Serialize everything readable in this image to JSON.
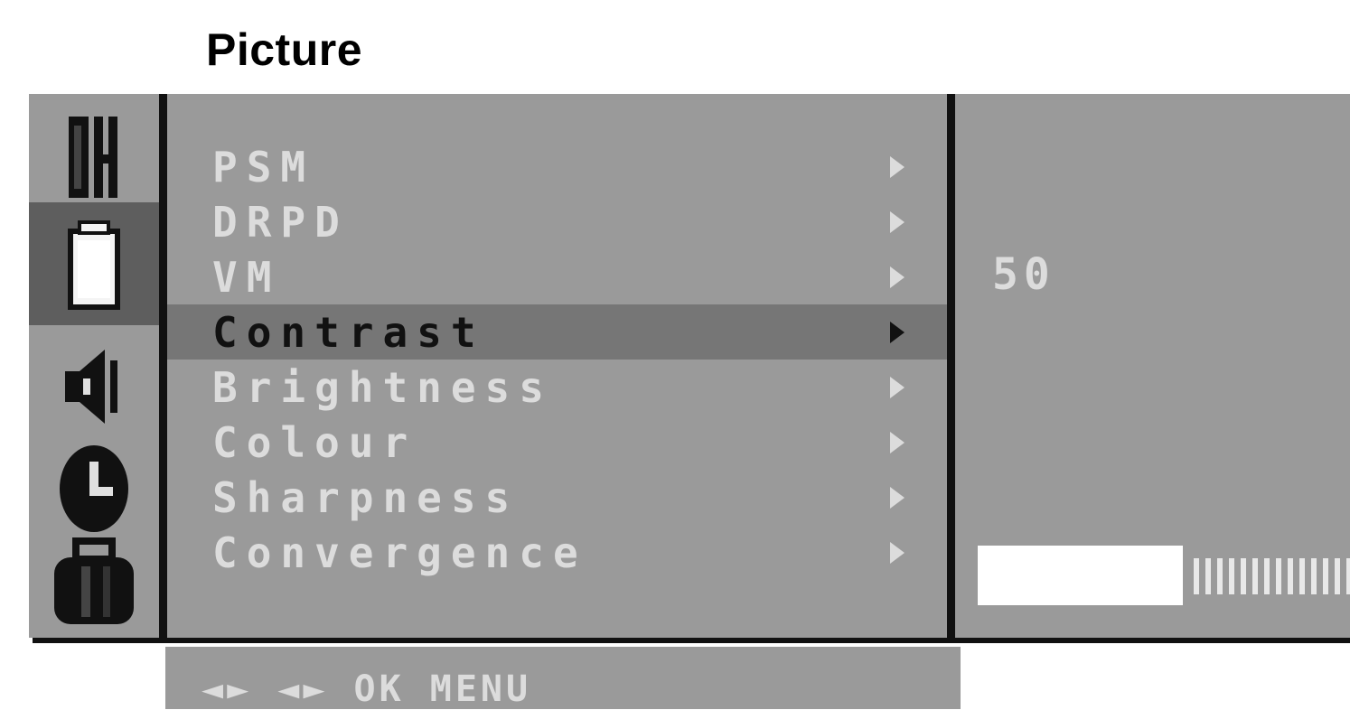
{
  "header": {
    "title": "Picture"
  },
  "sidebar": {
    "icons": [
      {
        "name": "channel-icon",
        "active": false
      },
      {
        "name": "picture-icon",
        "active": true
      },
      {
        "name": "sound-icon",
        "active": false
      },
      {
        "name": "time-icon",
        "active": false
      },
      {
        "name": "special-icon",
        "active": false
      }
    ]
  },
  "menu": {
    "items": [
      {
        "label": "PSM"
      },
      {
        "label": "DRPD"
      },
      {
        "label": "VM"
      },
      {
        "label": "Contrast",
        "selected": true
      },
      {
        "label": "Brightness"
      },
      {
        "label": "Colour"
      },
      {
        "label": "Sharpness"
      },
      {
        "label": "Convergence"
      }
    ]
  },
  "detail": {
    "value": "50",
    "level_fraction": 0.5
  },
  "help": {
    "text": "◄► ◄► OK MENU"
  },
  "colors": {
    "osd_bg": "#9a9a9a",
    "selected_bg": "#767676",
    "active_icon_bg": "#5e5e5e"
  }
}
